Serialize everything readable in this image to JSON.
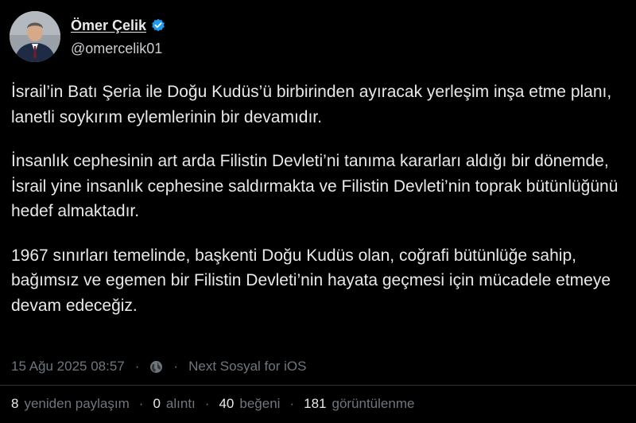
{
  "author": {
    "display_name": "Ömer Çelik",
    "handle": "@omercelik01",
    "avatar_icon": "avatar-photo",
    "verified_icon": "verified-badge-icon",
    "verified_color": "#1d9bf0"
  },
  "tweet": {
    "paragraphs": [
      "İsrail’in Batı Şeria ile Doğu Kudüs’ü birbirinden ayıracak yerleşim inşa etme planı, lanetli soykırım eylemlerinin bir devamıdır.",
      "İnsanlık cephesinin art arda Filistin Devleti’ni tanıma kararları aldığı bir dönemde, İsrail yine insanlık cephesine saldırmakta ve Filistin Devleti’nin toprak bütünlüğünü hedef almaktadır.",
      "1967 sınırları temelinde, başkenti Doğu Kudüs olan, coğrafi bütünlüğe sahip, bağımsız ve egemen bir Filistin Devleti’nin hayata geçmesi için mücadele etmeye devam edeceğiz."
    ]
  },
  "meta": {
    "timestamp": "15 Ağu 2025 08:57",
    "separator": "·",
    "visibility_icon": "globe-icon",
    "source": "Next Sosyal for iOS"
  },
  "stats": {
    "reposts_count": "8",
    "reposts_label": "yeniden paylaşım",
    "quotes_count": "0",
    "quotes_label": "alıntı",
    "likes_count": "40",
    "likes_label": "beğeni",
    "views_count": "181",
    "views_label": "görüntülenme",
    "separator": "·"
  },
  "colors": {
    "background": "#000000",
    "text": "#e7e9ea",
    "muted": "#6e767d",
    "accent": "#1d9bf0"
  }
}
